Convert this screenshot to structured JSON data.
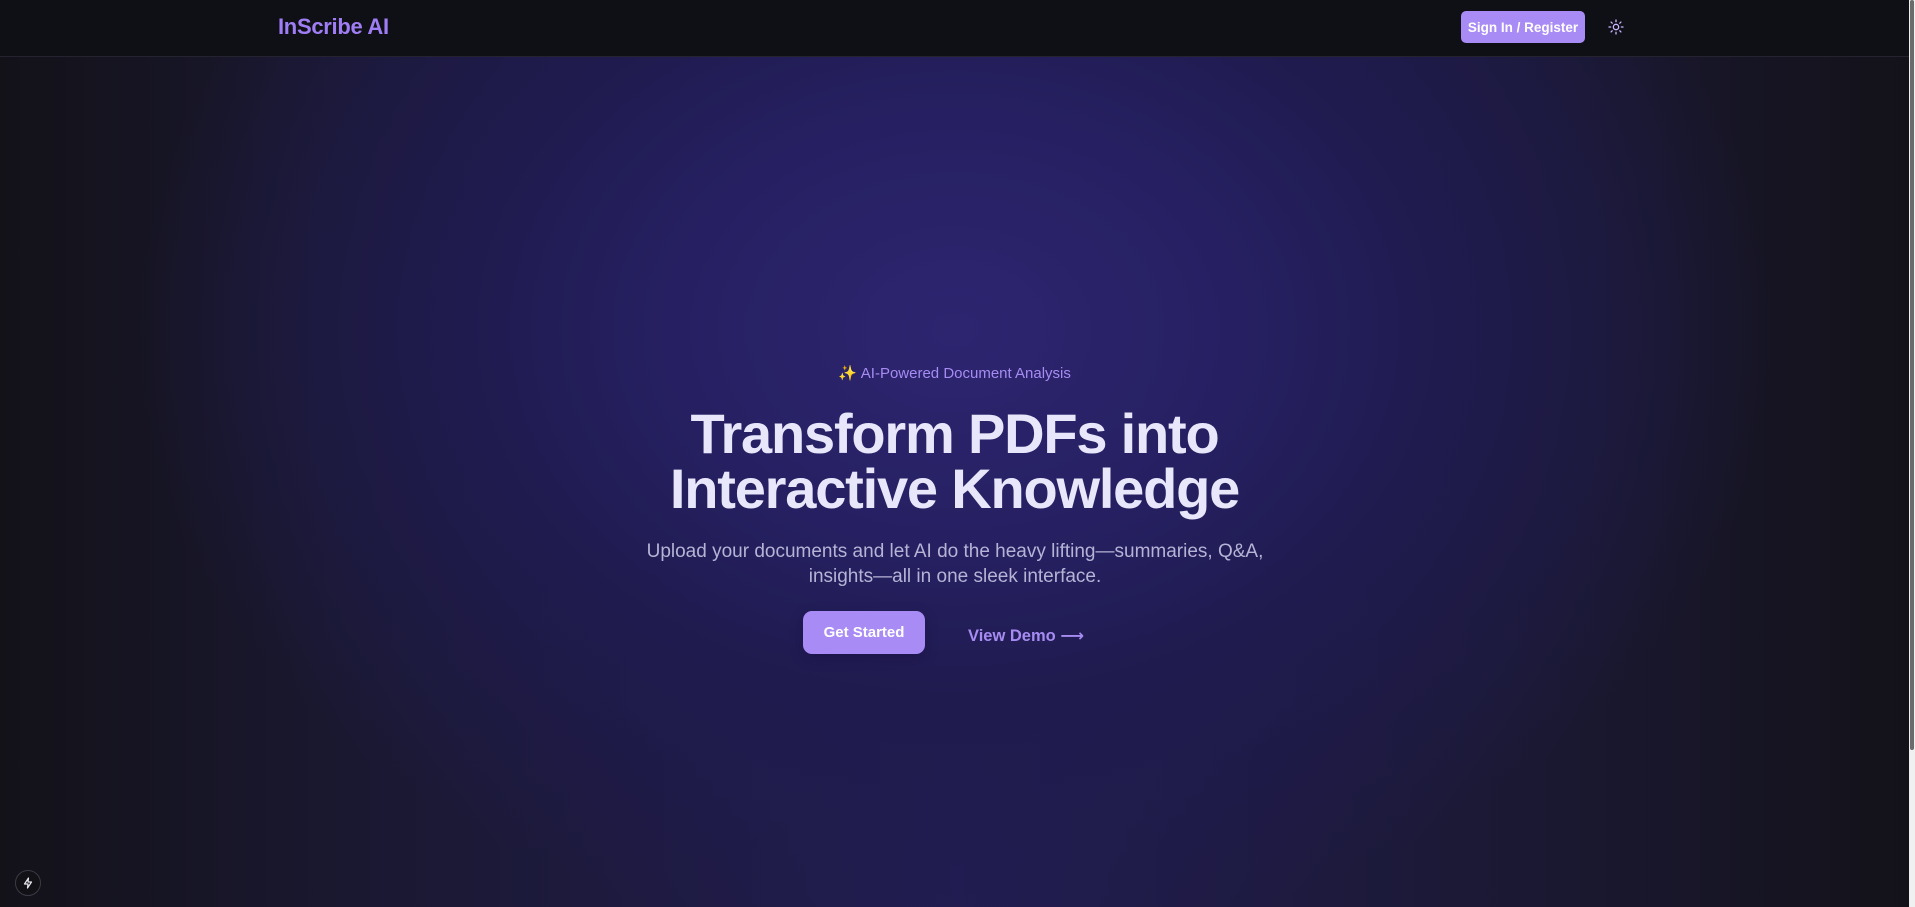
{
  "header": {
    "logo": "InScribe AI",
    "signin_label": "Sign In / Register",
    "theme_icon": "sun-icon"
  },
  "hero": {
    "badge_icon": "✨",
    "badge_text": "AI-Powered Document Analysis",
    "headline_line1": "Transform PDFs into",
    "headline_line2": "Interactive Knowledge",
    "subtitle": "Upload your documents and let AI do the heavy lifting—summaries, Q&A, insights—all in one sleek interface.",
    "primary_cta": "Get Started",
    "secondary_cta": "View Demo ⟶"
  },
  "dev_indicator": {
    "icon": "lightning-icon"
  },
  "colors": {
    "accent": "#a98bf5",
    "logo": "#9f7ef5",
    "header_bg": "#0f0f16",
    "headline": "#e7e6fb"
  }
}
